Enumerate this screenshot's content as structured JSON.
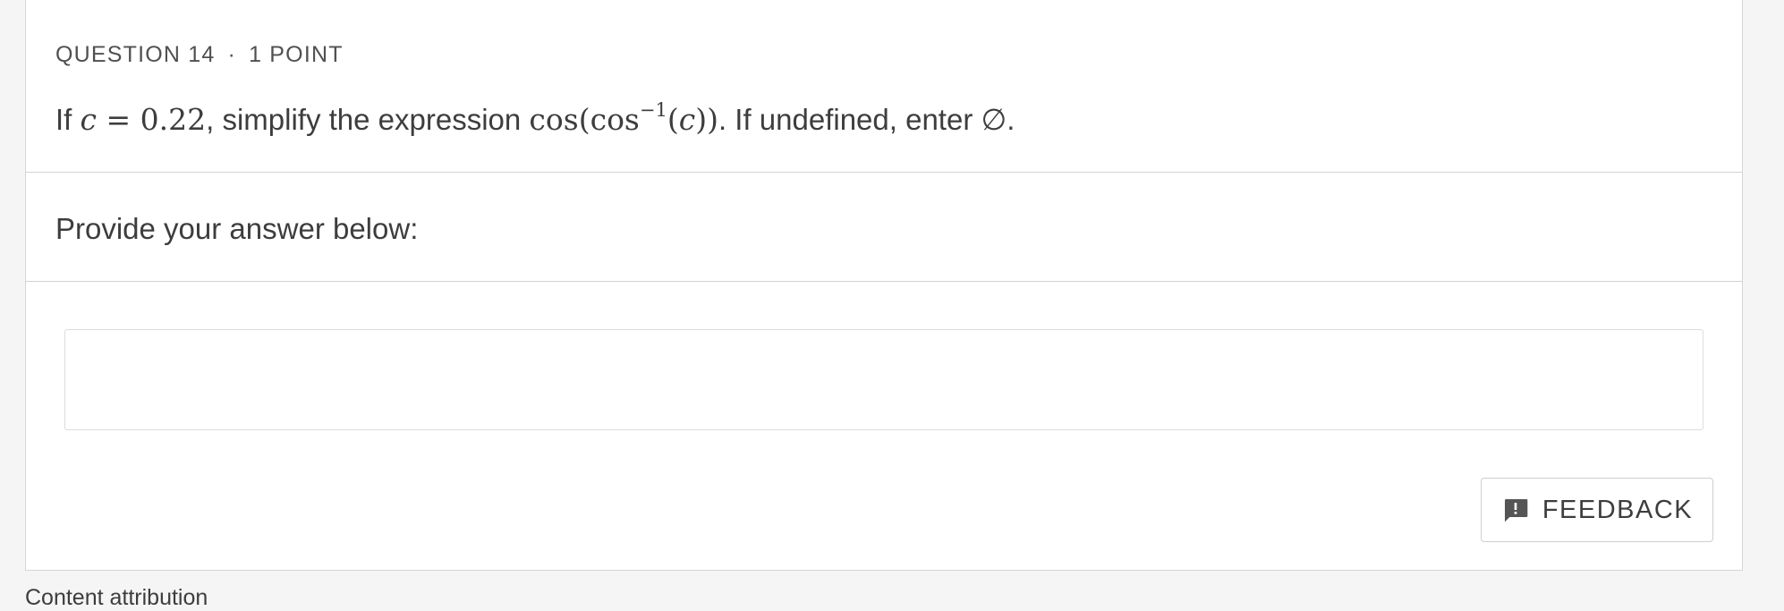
{
  "question": {
    "number_label": "QUESTION 14",
    "separator": "·",
    "points_label": "1 POINT",
    "text_prefix": "If ",
    "math_var": "c",
    "math_eq": " = 0.22",
    "text_mid": ", simplify the expression ",
    "math_expr_a": "cos(cos",
    "math_expr_sup": "−1",
    "math_expr_b": "(",
    "math_expr_var": "c",
    "math_expr_c": "))",
    "text_suffix": ". If undefined, enter ∅."
  },
  "answer": {
    "prompt": "Provide your answer below:",
    "value": "",
    "placeholder": ""
  },
  "feedback": {
    "label": "FEEDBACK",
    "icon": "feedback-icon"
  },
  "footer": {
    "attribution": "Content attribution"
  }
}
